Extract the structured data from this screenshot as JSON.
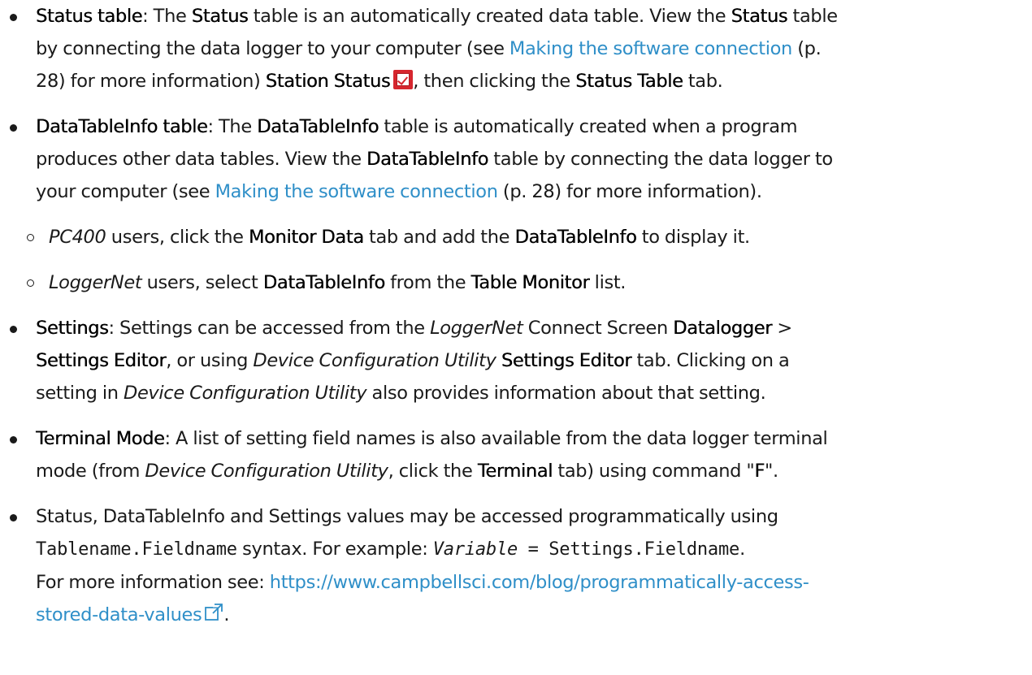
{
  "items": [
    {
      "l1": {
        "b1": "Status table",
        "t1": ": The ",
        "b2": "Status",
        "t2": " table is an automatically created data table. View the ",
        "b3": "Status",
        "t3": " table"
      },
      "l2": {
        "t1": "by connecting the data logger to your computer (see ",
        "link": "Making the software connection",
        "t2": " (p."
      },
      "l3": {
        "t1": "28) for more information) ",
        "b1": "Station Status",
        "t2": ", then clicking the ",
        "b2": "Status Table",
        "t3": " tab."
      }
    },
    {
      "l1": {
        "b1": "DataTableInfo table",
        "t1": ": The ",
        "b2": "DataTableInfo",
        "t2": " table is automatically created when a program"
      },
      "l2": {
        "t1": "produces other data tables. View the ",
        "b1": "DataTableInfo",
        "t2": " table by connecting the data logger to"
      },
      "l3": {
        "t1": "your computer (see ",
        "link": "Making the software connection",
        "t2": " (p. 28) for more information)."
      },
      "sub": [
        {
          "i1": "PC400",
          "t1": " users, click the ",
          "b1": "Monitor Data",
          "t2": " tab and add the ",
          "b2": "DataTableInfo",
          "t3": " to display it."
        },
        {
          "i1": "LoggerNet",
          "t1": " users, select ",
          "b1": "DataTableInfo",
          "t2": " from the ",
          "b2": "Table Monitor",
          "t3": " list."
        }
      ]
    },
    {
      "l1": {
        "b1": "Settings",
        "t1": ": Settings can be accessed from the ",
        "i1": "LoggerNet",
        "t2": " Connect Screen ",
        "b2": "Datalogger",
        "t3": " >"
      },
      "l2": {
        "b1": "Settings Editor",
        "t1": ", or using ",
        "i1": "Device Configuration Utility",
        "b2": " Settings Editor",
        "t2": " tab. Clicking on a"
      },
      "l3": {
        "t1": "setting in ",
        "i1": "Device Configuration Utility",
        "t2": " also provides information about that setting."
      }
    },
    {
      "l1": {
        "b1": "Terminal Mode",
        "t1": ": A list of setting field names is also available from the data logger terminal"
      },
      "l2": {
        "t1": "mode (from ",
        "i1": "Device Configuration Utility",
        "t2": ", click the ",
        "b1": "Terminal",
        "t3": " tab) using command \"",
        "b2": "F",
        "t4": "\"."
      }
    },
    {
      "l1": {
        "t1": "Status, DataTableInfo and Settings values may be accessed programmatically using"
      },
      "l2": {
        "m1": "Tablename.Fieldname",
        "t1": " syntax. For example: ",
        "mi1": "Variable",
        "m2": " = Settings.Fieldname",
        "t2": "."
      },
      "l3": {
        "t1": "For more information see: ",
        "link": "https://www.campbellsci.com/blog/programmatically-access-"
      },
      "l4": {
        "link": "stored-data-values",
        "t1": "."
      }
    }
  ]
}
